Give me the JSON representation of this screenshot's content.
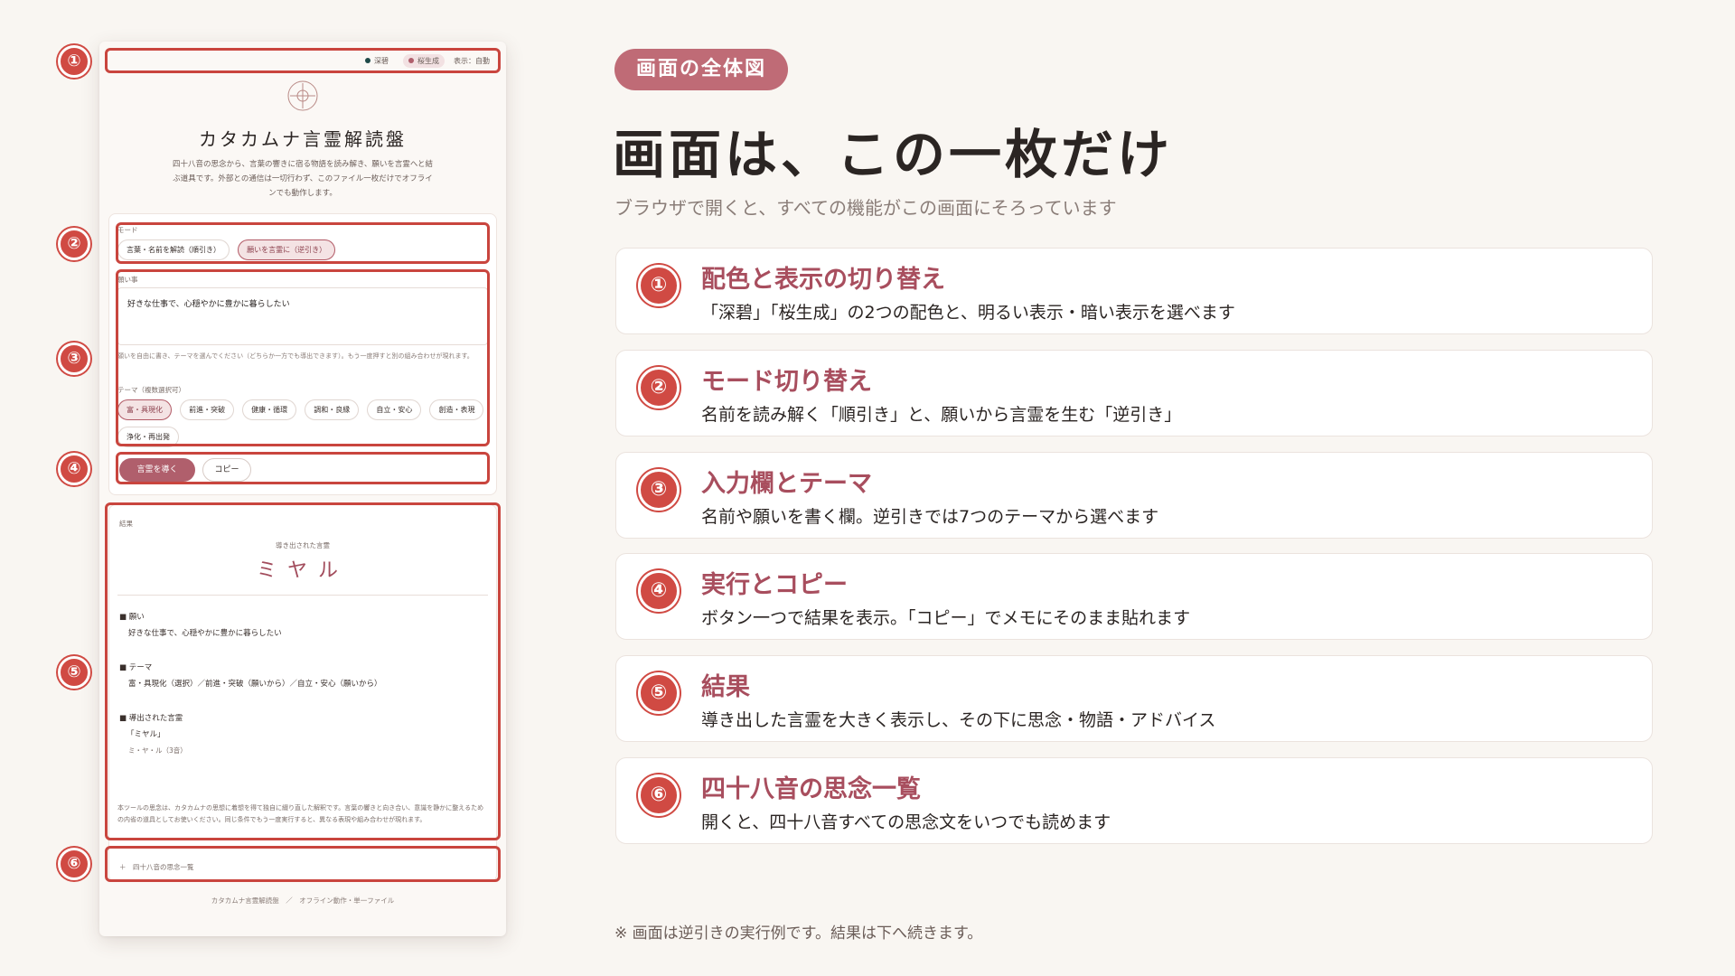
{
  "app": {
    "top_bar": {
      "theme_1": "深碧",
      "theme_2": "桜生成",
      "display": "表示：自動"
    },
    "title": "カタカムナ言霊解読盤",
    "description": "四十八音の思念から、言葉の響きに宿る物語を読み解き、願いを言霊へと結ぶ道具です。外部との通信は一切行わず、このファイル一枚だけでオフラインでも動作します。",
    "mode": {
      "label": "モード",
      "options": [
        "言葉・名前を解読（順引き）",
        "願いを言霊に（逆引き）"
      ]
    },
    "wish": {
      "label": "願い事",
      "value": "好きな仕事で、心穏やかに豊かに暮らしたい",
      "hint": "願いを自由に書き、テーマを選んでください（どちらか一方でも導出できます）。もう一度押すと別の組み合わせが現れます。"
    },
    "themes": {
      "label": "テーマ（複数選択可）",
      "items": [
        "富・具現化",
        "前進・突破",
        "健康・循環",
        "調和・良縁",
        "自立・安心",
        "創造・表現",
        "浄化・再出発"
      ]
    },
    "buttons": {
      "run": "言霊を導く",
      "copy": "コピー"
    },
    "result": {
      "label": "結果",
      "derived_caption": "導き出された言霊",
      "word": "ミヤル",
      "wish_heading": "■ 願い",
      "wish_text": "好きな仕事で、心穏やかに豊かに暮らしたい",
      "theme_heading": "■ テーマ",
      "theme_text": "富・具現化（選択）／前進・突破（願いから）／自立・安心（願いから）",
      "derived_heading": "■ 導出された言霊",
      "derived_word": "「ミヤル」",
      "derived_reading": "ミ・ヤ・ル（3音）",
      "disclaimer": "本ツールの思念は、カタカムナの思想に着想を得て独自に綴り直した解釈です。言葉の響きと向き合い、意識を静かに整えるための内省の道具としてお使いください。同じ条件でもう一度実行すると、異なる表現や組み合わせが現れます。"
    },
    "list_toggle": "＋　四十八音の思念一覧",
    "footer": "カタカムナ言霊解読盤　／　オフライン動作・単一ファイル"
  },
  "callouts": [
    "①",
    "②",
    "③",
    "④",
    "⑤",
    "⑥"
  ],
  "badge": "画面の全体図",
  "headline": "画面は、この一枚だけ",
  "subhead": "ブラウザで開くと、すべての機能がこの画面にそろっています",
  "features": [
    {
      "num": "①",
      "title": "配色と表示の切り替え",
      "desc": "「深碧」「桜生成」の2つの配色と、明るい表示・暗い表示を選べます"
    },
    {
      "num": "②",
      "title": "モード切り替え",
      "desc": "名前を読み解く「順引き」と、願いから言霊を生む「逆引き」"
    },
    {
      "num": "③",
      "title": "入力欄とテーマ",
      "desc": "名前や願いを書く欄。逆引きでは7つのテーマから選べます"
    },
    {
      "num": "④",
      "title": "実行とコピー",
      "desc": "ボタン一つで結果を表示。「コピー」でメモにそのまま貼れます"
    },
    {
      "num": "⑤",
      "title": "結果",
      "desc": "導き出した言霊を大きく表示し、その下に思念・物語・アドバイス"
    },
    {
      "num": "⑥",
      "title": "四十八音の思念一覧",
      "desc": "開くと、四十八音すべての思念文をいつでも読めます"
    }
  ],
  "note": "※ 画面は逆引きの実行例です。結果は下へ続きます。",
  "colors": {
    "accent": "#bf6b76",
    "callout": "#d04a43",
    "theme_deep": "#1f4a48",
    "theme_sakura": "#b05f6c"
  }
}
